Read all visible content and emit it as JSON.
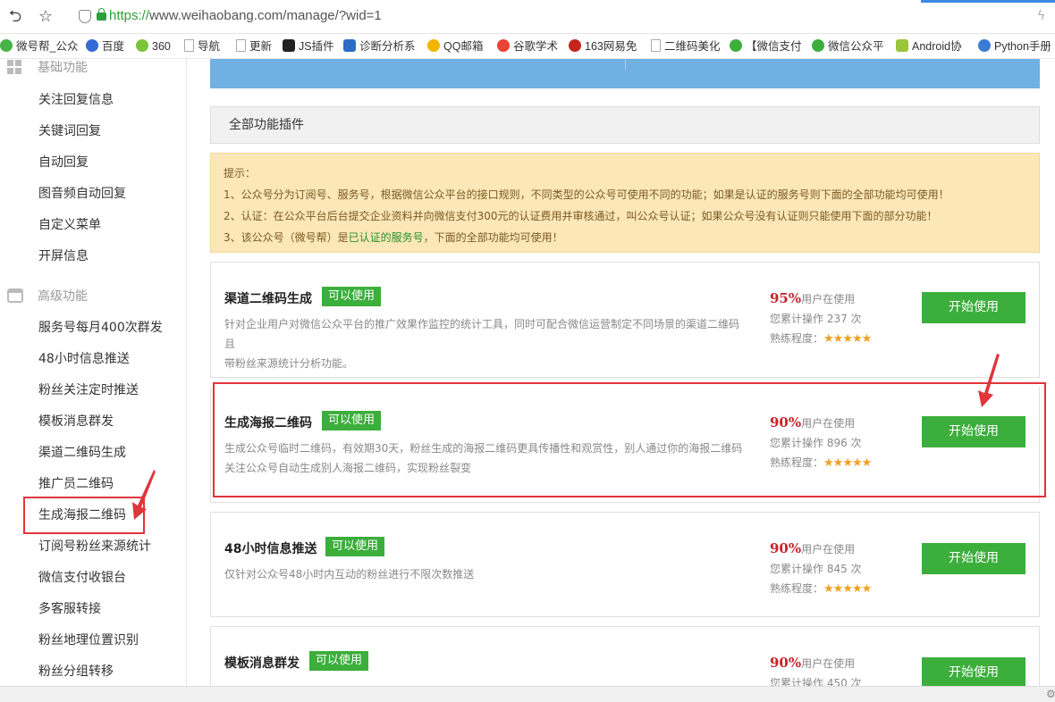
{
  "browser": {
    "url_scheme": "https://",
    "url_rest": "www.weihaobang.com/manage/?wid=1",
    "bookmarks": [
      "微号帮_公众",
      "百度",
      "360",
      "导航",
      "更新",
      "JS插件",
      "诊断分析系",
      "QQ邮箱",
      "谷歌学术",
      "163网易免",
      "二维码美化",
      "【微信支付",
      "微信公众平",
      "Android协",
      "Python手册"
    ]
  },
  "sidebar": {
    "section_basic": "基础功能",
    "basic_items": [
      "关注回复信息",
      "关键词回复",
      "自动回复",
      "图音频自动回复",
      "自定义菜单",
      "开屏信息"
    ],
    "section_advanced": "高级功能",
    "advanced_items": [
      "服务号每月400次群发",
      "48小时信息推送",
      "粉丝关注定时推送",
      "模板消息群发",
      "渠道二维码生成",
      "推广员二维码",
      "生成海报二维码",
      "订阅号粉丝来源统计",
      "微信支付收银台",
      "多客服转接",
      "粉丝地理位置识别",
      "粉丝分组转移"
    ]
  },
  "main": {
    "panel_title": "全部功能插件",
    "tips": {
      "heading": "提示：",
      "line1": "1、公众号分为订阅号、服务号，根据微信公众平台的接口规则，不同类型的公众号可使用不同的功能；如果是认证的服务号则下面的全部功能均可使用！",
      "line2": "2、认证：在公众平台后台提交企业资料并向微信支付300元的认证费用并审核通过，叫公众号认证；如果公众号没有认证则只能使用下面的部分功能！",
      "line3_a": "3、该公众号（微号帮）是",
      "line3_green": "已认证的服务号",
      "line3_b": "，下面的全部功能均可使用！"
    },
    "stat_users_suffix": "用户在使用",
    "stat_level_label": "熟练程度：",
    "stars": "★★★★★",
    "badge": "可以使用",
    "button": "开始使用",
    "cards": [
      {
        "title": "渠道二维码生成",
        "desc1": "针对企业用户对微信公众平台的推广效果作监控的统计工具，同时可配合微信运营制定不同场景的渠道二维码且",
        "desc2": "带粉丝来源统计分析功能。",
        "pct": "95%",
        "ops": "您累计操作 237 次"
      },
      {
        "title": "生成海报二维码",
        "desc1": "生成公众号临时二维码，有效期30天，粉丝生成的海报二维码更具传播性和观赏性，别人通过你的海报二维码",
        "desc2": "关注公众号自动生成别人海报二维码，实现粉丝裂变",
        "pct": "90%",
        "ops": "您累计操作 896 次"
      },
      {
        "title": "48小时信息推送",
        "desc1": "仅针对公众号48小时内互动的粉丝进行不限次数推送",
        "desc2": "",
        "pct": "90%",
        "ops": "您累计操作 845 次"
      },
      {
        "title": "模板消息群发",
        "desc1": "",
        "desc2": "",
        "pct": "90%",
        "ops": "您累计操作 450 次"
      }
    ]
  },
  "colors": {
    "green": "#3cae3c",
    "red_highlight": "#e0353b",
    "tips_bg": "#fbe7b8",
    "blue_banner": "#6fb1e3"
  }
}
